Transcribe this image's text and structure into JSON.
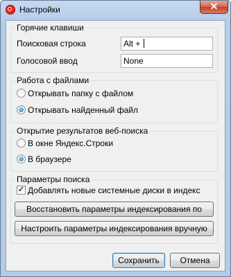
{
  "window": {
    "title": "Настройки",
    "close_glyph": "✕"
  },
  "hotkeys": {
    "legend": "Горячие клавиши",
    "search_bar_label": "Поисковая строка",
    "search_bar_value": "Alt + ",
    "voice_input_label": "Голосовой ввод",
    "voice_input_value": "None"
  },
  "files": {
    "legend": "Работа с файлами",
    "options": [
      "Открывать папку с файлом",
      "Открывать найденный файл"
    ],
    "selected_index": 1
  },
  "web": {
    "legend": "Открытие результатов веб-поиска",
    "options": [
      "В окне Яндекс.Строки",
      "В браузере"
    ],
    "selected_index": 1
  },
  "search": {
    "legend": "Параметры поиска",
    "add_disks_label": "Добавлять новые системные диски в индекс",
    "add_disks_checked": true,
    "restore_button": "Восстановить параметры индексирования по умолчанию",
    "configure_button": "Настроить параметры индексирования вручную"
  },
  "footer": {
    "save_button": "Сохранить",
    "cancel_button": "Отмена"
  },
  "colors": {
    "titlebar": "#b6cce8",
    "close_button": "#c24128",
    "radio_selected": "#1b6fb8"
  },
  "icons": {
    "app": "yandex-logo-icon",
    "checkmark": "✓"
  }
}
